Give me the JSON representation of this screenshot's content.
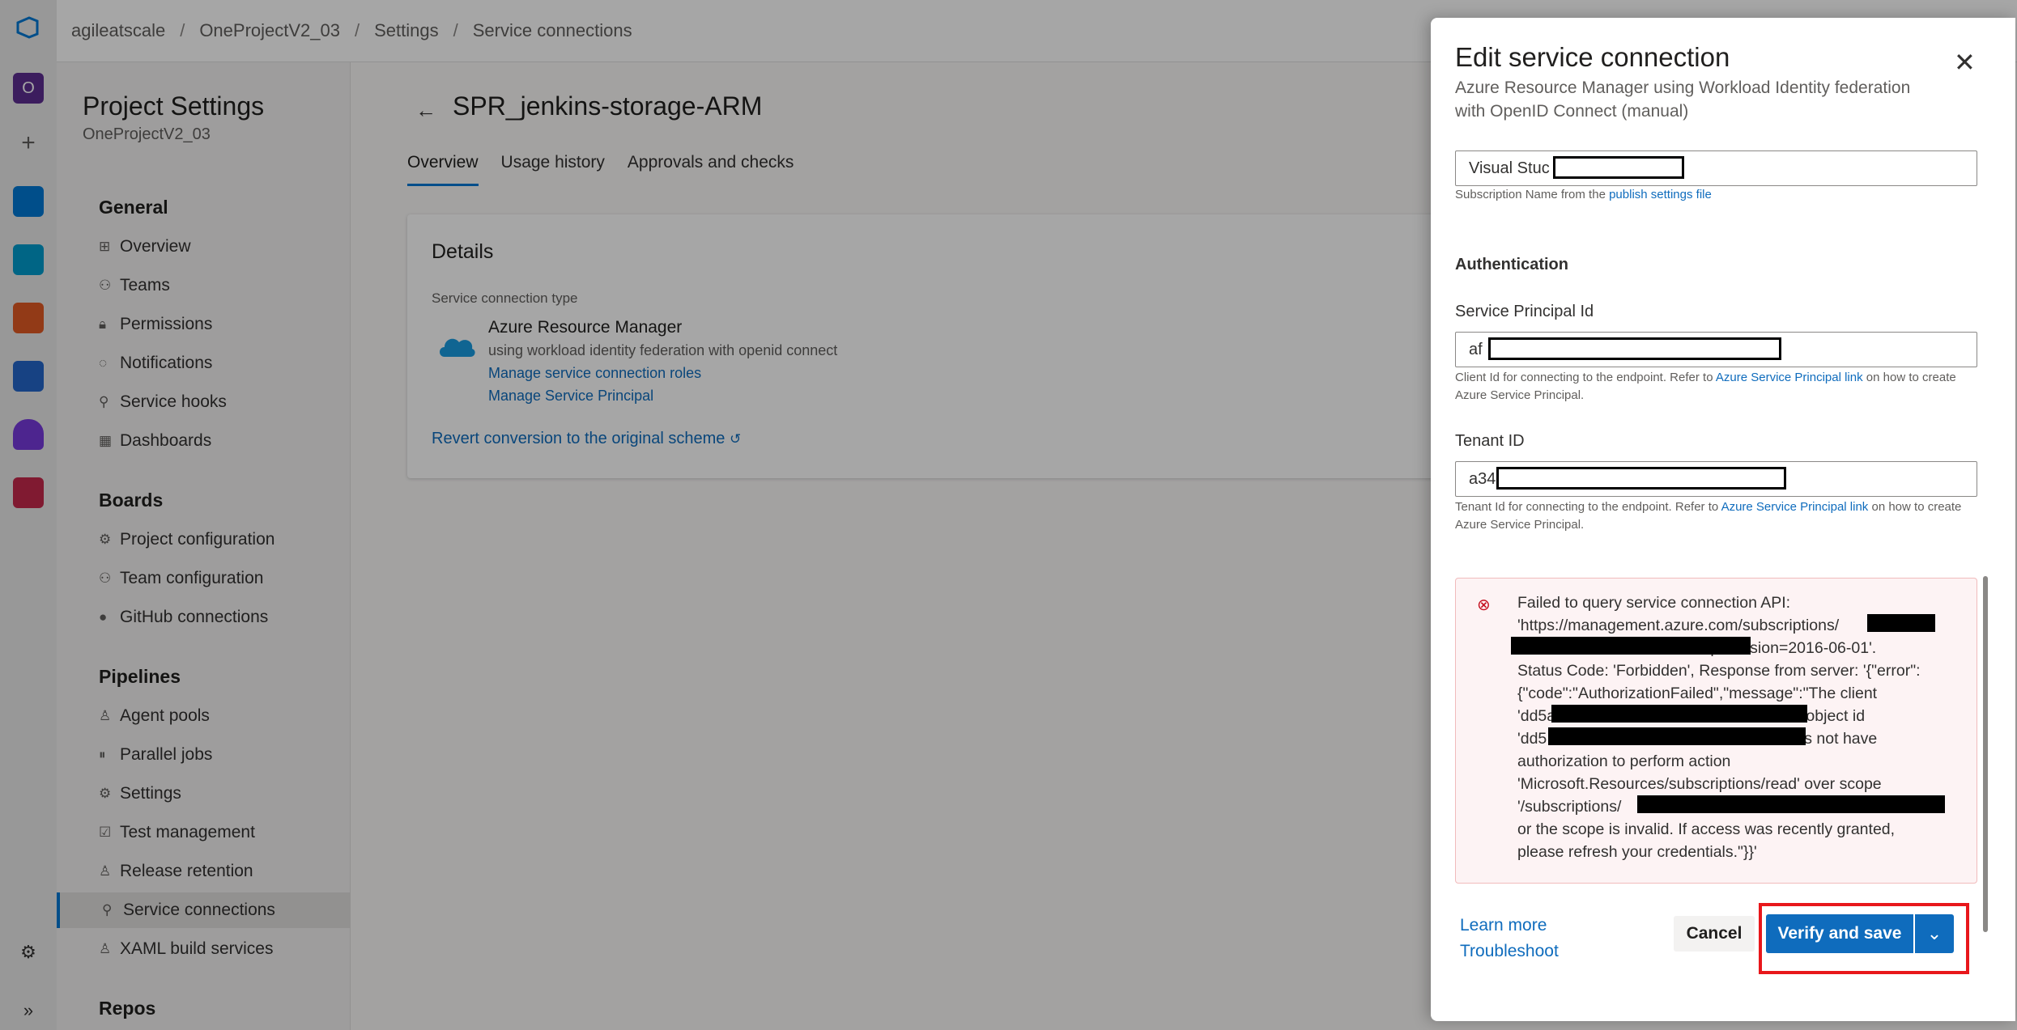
{
  "breadcrumb": [
    "agileatscale",
    "OneProjectV2_03",
    "Settings",
    "Service connections"
  ],
  "nav": {
    "title": "Project Settings",
    "project": "OneProjectV2_03",
    "groups": [
      {
        "label": "General",
        "items": [
          "Overview",
          "Teams",
          "Permissions",
          "Notifications",
          "Service hooks",
          "Dashboards"
        ]
      },
      {
        "label": "Boards",
        "items": [
          "Project configuration",
          "Team configuration",
          "GitHub connections"
        ]
      },
      {
        "label": "Pipelines",
        "items": [
          "Agent pools",
          "Parallel jobs",
          "Settings",
          "Test management",
          "Release retention",
          "Service connections",
          "XAML build services"
        ]
      },
      {
        "label": "Repos",
        "items": []
      }
    ],
    "selected": "Service connections"
  },
  "main": {
    "title": "SPR_jenkins-storage-ARM",
    "tabs": [
      "Overview",
      "Usage history",
      "Approvals and checks"
    ],
    "details": {
      "heading": "Details",
      "type_label": "Service connection type",
      "type_name": "Azure Resource Manager",
      "type_desc": "using workload identity federation with openid connect",
      "link_roles": "Manage service connection roles",
      "link_principal": "Manage Service Principal",
      "revert": "Revert conversion to the original scheme"
    }
  },
  "panel": {
    "title": "Edit service connection",
    "subtitle": "Azure Resource Manager using Workload Identity federation with OpenID Connect (manual)",
    "subscription_value": "Visual Stuc",
    "subscription_hint": "Subscription Name from the",
    "subscription_hint_link": "publish settings file",
    "auth_heading": "Authentication",
    "spid_label": "Service Principal Id",
    "spid_value": "af",
    "spid_hint_pre": "Client Id for connecting to the endpoint. Refer to",
    "spid_hint_link": "Azure Service Principal link",
    "spid_hint_post": "on how to create Azure Service Principal.",
    "tenant_label": "Tenant ID",
    "tenant_value": "a34",
    "tenant_hint_pre": "Tenant Id for connecting to the endpoint. Refer to",
    "tenant_hint_link": "Azure Service Principal link",
    "tenant_hint_post": "on how to create Azure Service Principal.",
    "error_text": "Failed to query service connection API:\n'https://management.azure.com/subscriptions/           -\n                                        ?api-version=2016-06-01'.\nStatus Code: 'Forbidden', Response from server: '{\"error\":\n{\"code\":\"AuthorizationFailed\",\"message\":\"The client\n'dd5a                                          878' with object id\n'dd5                                             878' does not have\nauthorization to perform action\n'Microsoft.Resources/subscriptions/read' over scope\n'/subscriptions/                                                       '\nor the scope is invalid. If access was recently granted,\nplease refresh your credentials.\"}}'",
    "learn_more": "Learn more",
    "troubleshoot": "Troubleshoot",
    "cancel": "Cancel",
    "verify": "Verify and save"
  },
  "colors": {
    "accent": "#0f6cbd",
    "error_bg": "#fdf3f4",
    "highlight": "#e8171b"
  }
}
